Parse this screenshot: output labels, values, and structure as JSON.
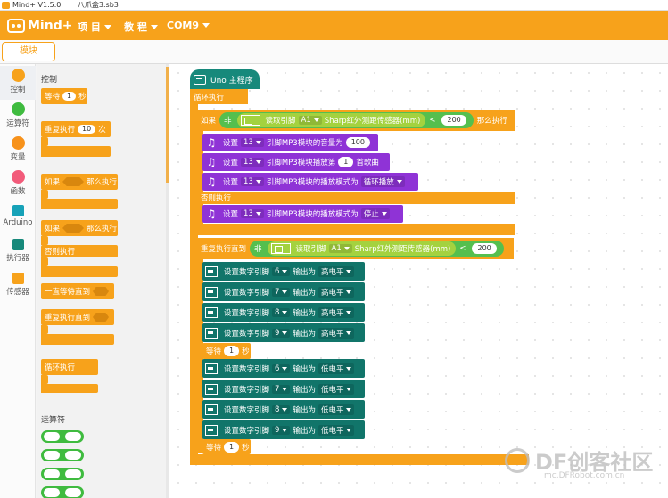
{
  "titlebar": {
    "app": "Mind+ V1.5.0",
    "file": "八爪盒3.sb3"
  },
  "menubar": {
    "logo": "Mind+",
    "items": [
      {
        "label": "项 目"
      },
      {
        "label": "教 程"
      },
      {
        "label": "COM9"
      }
    ]
  },
  "tabs": {
    "blocks": "模块"
  },
  "categories": [
    {
      "label": "控制",
      "color": "#f7a21b"
    },
    {
      "label": "运算符",
      "color": "#3fbb3f"
    },
    {
      "label": "变量",
      "color": "#f7921b"
    },
    {
      "label": "函数",
      "color": "#f25b7a"
    },
    {
      "label": "Arduino",
      "color": "#17a2b8"
    },
    {
      "label": "执行器",
      "color": "#17897b"
    },
    {
      "label": "传感器",
      "color": "#f7a21b"
    }
  ],
  "palette": {
    "title_control": "控制",
    "wait": {
      "prefix": "等待",
      "value": "1",
      "suffix": "秒"
    },
    "repeat": {
      "prefix": "重复执行",
      "value": "10",
      "suffix": "次"
    },
    "if_then": {
      "prefix": "如果",
      "suffix": "那么执行"
    },
    "if_else": {
      "prefix": "如果",
      "suffix": "那么执行",
      "else": "否则执行"
    },
    "wait_until": "一直等待直到",
    "repeat_until": "重复执行直到",
    "forever": "循环执行",
    "title_operators": "运算符"
  },
  "script": {
    "hat": "Uno 主程序",
    "loop": "循环执行",
    "if": {
      "prefix": "如果",
      "not": "非",
      "read_label": "读取引脚",
      "pin": "A1",
      "sensor": "Sharp红外测距传感器(mm)",
      "op": "<",
      "threshold": "200",
      "then": "那么执行"
    },
    "mp3": [
      {
        "set": "设置",
        "pin": "13",
        "text": "引脚MP3模块的音量为",
        "value": "100"
      },
      {
        "set": "设置",
        "pin": "13",
        "text": "引脚MP3模块播放第",
        "value": "1",
        "suffix": "首歌曲"
      },
      {
        "set": "设置",
        "pin": "13",
        "text": "引脚MP3模块的播放模式为",
        "mode": "循环播放"
      }
    ],
    "else_label": "否则执行",
    "mp3_else": {
      "set": "设置",
      "pin": "13",
      "text": "引脚MP3模块的播放模式为",
      "mode": "停止"
    },
    "repeat_until": {
      "prefix": "重复执行直到",
      "not": "非",
      "read_label": "读取引脚",
      "pin": "A1",
      "sensor": "Sharp红外测距传感器(mm)",
      "op": "<",
      "threshold": "200"
    },
    "digital_high": [
      {
        "set": "设置数字引脚",
        "pin": "6",
        "out": "输出为",
        "level": "高电平"
      },
      {
        "set": "设置数字引脚",
        "pin": "7",
        "out": "输出为",
        "level": "高电平"
      },
      {
        "set": "设置数字引脚",
        "pin": "8",
        "out": "输出为",
        "level": "高电平"
      },
      {
        "set": "设置数字引脚",
        "pin": "9",
        "out": "输出为",
        "level": "高电平"
      }
    ],
    "wait1": {
      "prefix": "等待",
      "value": "1",
      "suffix": "秒"
    },
    "digital_low": [
      {
        "set": "设置数字引脚",
        "pin": "6",
        "out": "输出为",
        "level": "低电平"
      },
      {
        "set": "设置数字引脚",
        "pin": "7",
        "out": "输出为",
        "level": "低电平"
      },
      {
        "set": "设置数字引脚",
        "pin": "8",
        "out": "输出为",
        "level": "低电平"
      },
      {
        "set": "设置数字引脚",
        "pin": "9",
        "out": "输出为",
        "level": "低电平"
      }
    ],
    "wait2": {
      "prefix": "等待",
      "value": "1",
      "suffix": "秒"
    }
  },
  "watermark": {
    "text": "DF创客社区",
    "sub": "mc.DFRobot.com.cn"
  },
  "colors": {
    "control": "#f7a21b",
    "operator": "#3fbb3f",
    "mp3": "#8f33d6",
    "digital": "#11756a",
    "hat": "#17897b"
  }
}
